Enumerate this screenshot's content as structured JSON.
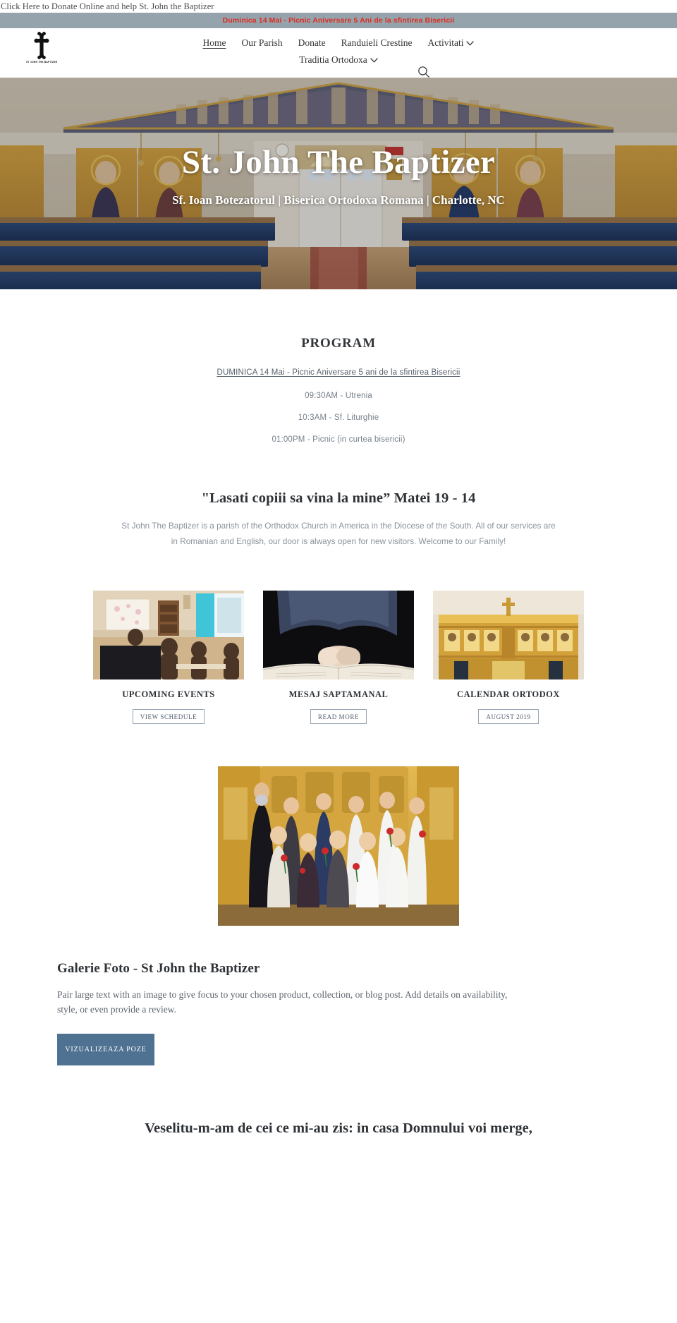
{
  "donate_bar": {
    "text": "Click Here to Donate Online and help St. John the Baptizer"
  },
  "announcement": {
    "text": "Duminica 14 Mai - Picnic Aniversare 5 Ani de la sfintirea Bisericii",
    "background": "#94a3ac",
    "text_color": "#e02b20"
  },
  "header": {
    "logo_caption": "ST JOHN THE BAPTIZER",
    "nav_row1": [
      {
        "label": "Home",
        "active": true,
        "has_dropdown": false
      },
      {
        "label": "Our Parish",
        "active": false,
        "has_dropdown": false
      },
      {
        "label": "Donate",
        "active": false,
        "has_dropdown": false
      },
      {
        "label": "Randuieli Crestine",
        "active": false,
        "has_dropdown": false
      },
      {
        "label": "Activitati",
        "active": false,
        "has_dropdown": true
      }
    ],
    "nav_row2": [
      {
        "label": "Traditia Ortodoxa",
        "active": false,
        "has_dropdown": true
      }
    ]
  },
  "hero": {
    "title": "St. John The Baptizer",
    "subtitle": "Sf. Ioan Botezatorul | Biserica Ortodoxa Romana | Charlotte, NC"
  },
  "program": {
    "title": "PROGRAM",
    "featured_link": "DUMINICA 14 Mai - Picnic Aniversare 5 ani de la sfintirea Bisericii",
    "lines": [
      "09:30AM - Utrenia",
      "10:3AM - Sf. Liturghie",
      "01:00PM - Picnic (in curtea bisericii)"
    ]
  },
  "verse": {
    "title": "\"Lasati copiii sa vina la mine” Matei 19 - 14",
    "body": "St John The Baptizer is a parish of the Orthodox Church in America in the Diocese of the South. All of our services are in Romanian and English, our door is always open for new visitors. Welcome to our Family!"
  },
  "cards": [
    {
      "title": "UPCOMING EVENTS",
      "button": "VIEW SCHEDULE",
      "image": "classroom-students-photo"
    },
    {
      "title": "MESAJ SAPTAMANAL",
      "button": "READ MORE",
      "image": "praying-hands-bible-photo"
    },
    {
      "title": "CALENDAR ORTODOX",
      "button": "AUGUST 2019",
      "image": "church-iconostasis-photo"
    }
  ],
  "gallery": {
    "image": "children-with-roses-in-church-photo",
    "title": "Galerie Foto - St John the Baptizer",
    "body": "Pair large text with an image to give focus to your chosen product, collection, or blog post. Add details on availability, style, or even provide a review.",
    "button": "VIZUALIZEAZA POZE",
    "button_color": "#4f7292"
  },
  "bottom_verse": {
    "text": "Veselitu-m-am de cei ce mi-au zis: in casa Domnului voi merge,"
  }
}
